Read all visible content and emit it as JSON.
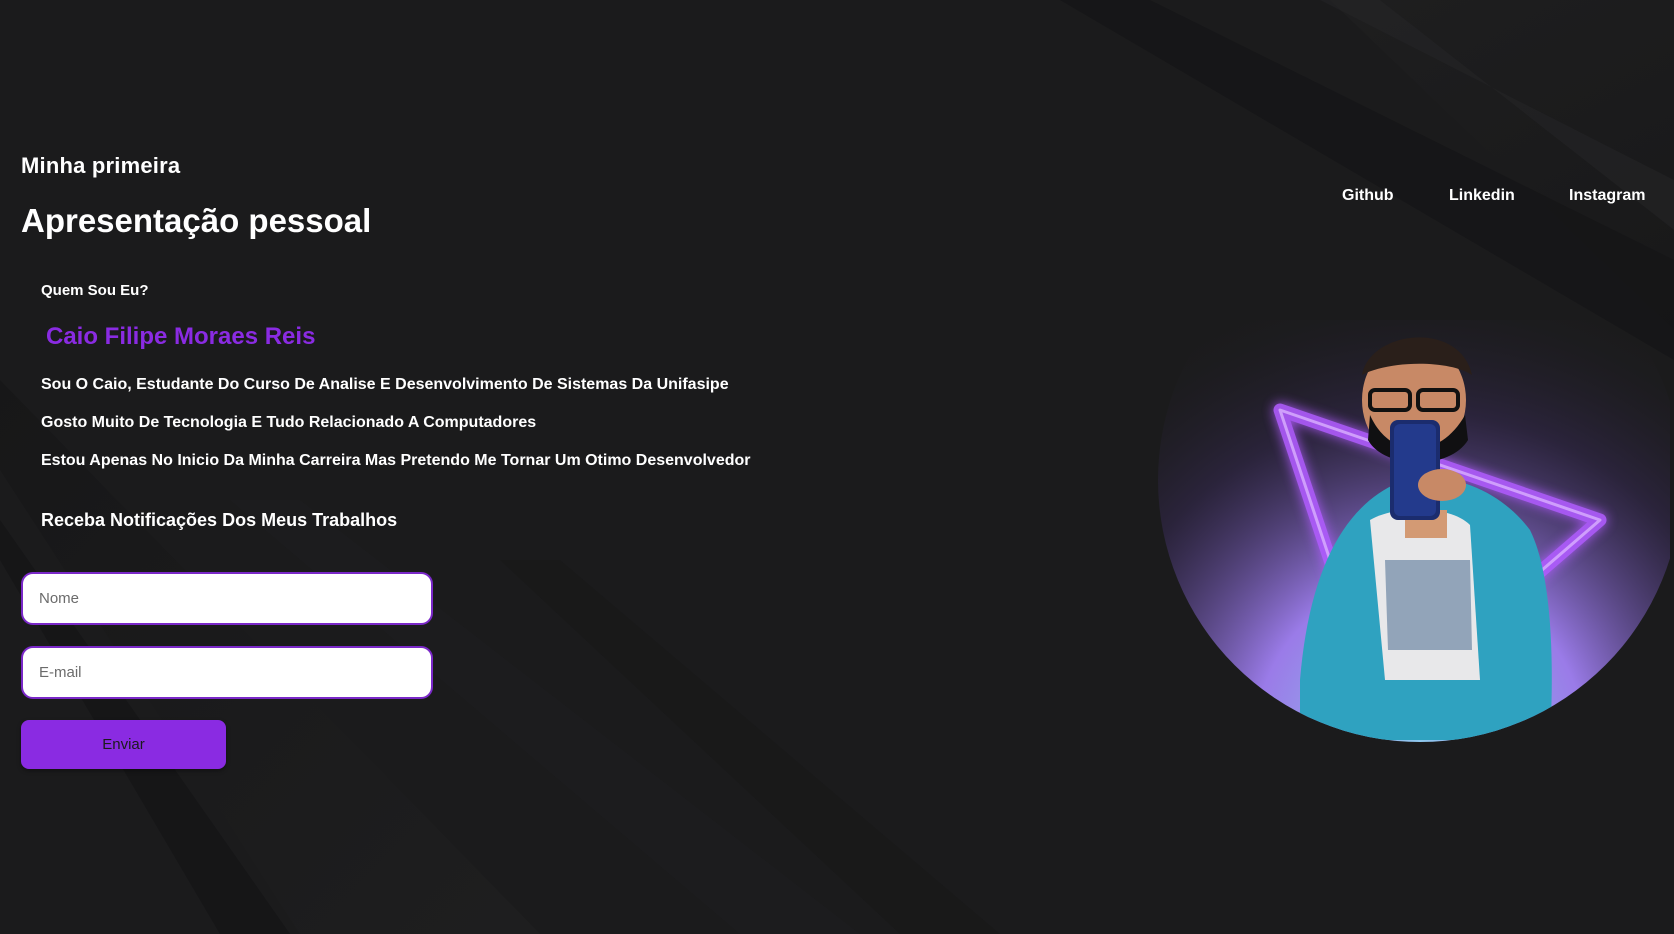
{
  "header": {
    "kicker": "Minha primeira",
    "title": "Apresentação pessoal"
  },
  "nav": {
    "github": "Github",
    "linkedin": "Linkedin",
    "instagram": "Instagram"
  },
  "about": {
    "section_label": "Quem Sou Eu?",
    "name": "Caio Filipe Moraes Reis",
    "bio": [
      "Sou O Caio, Estudante Do Curso De Analise E Desenvolvimento De Sistemas Da Unifasipe",
      "Gosto Muito De Tecnologia E Tudo Relacionado A Computadores",
      "Estou Apenas No Inicio Da Minha Carreira Mas Pretendo Me Tornar Um Otimo Desenvolvedor"
    ]
  },
  "subscribe": {
    "heading": "Receba Notificações Dos Meus Trabalhos",
    "name_placeholder": "Nome",
    "email_placeholder": "E-mail",
    "button_label": "Enviar"
  },
  "colors": {
    "background": "#1b1b1c",
    "accent": "#8a2be2",
    "text": "#ffffff",
    "input_border": "#7a28c8"
  },
  "icons": {
    "profile_frame": "neon-triangle"
  }
}
